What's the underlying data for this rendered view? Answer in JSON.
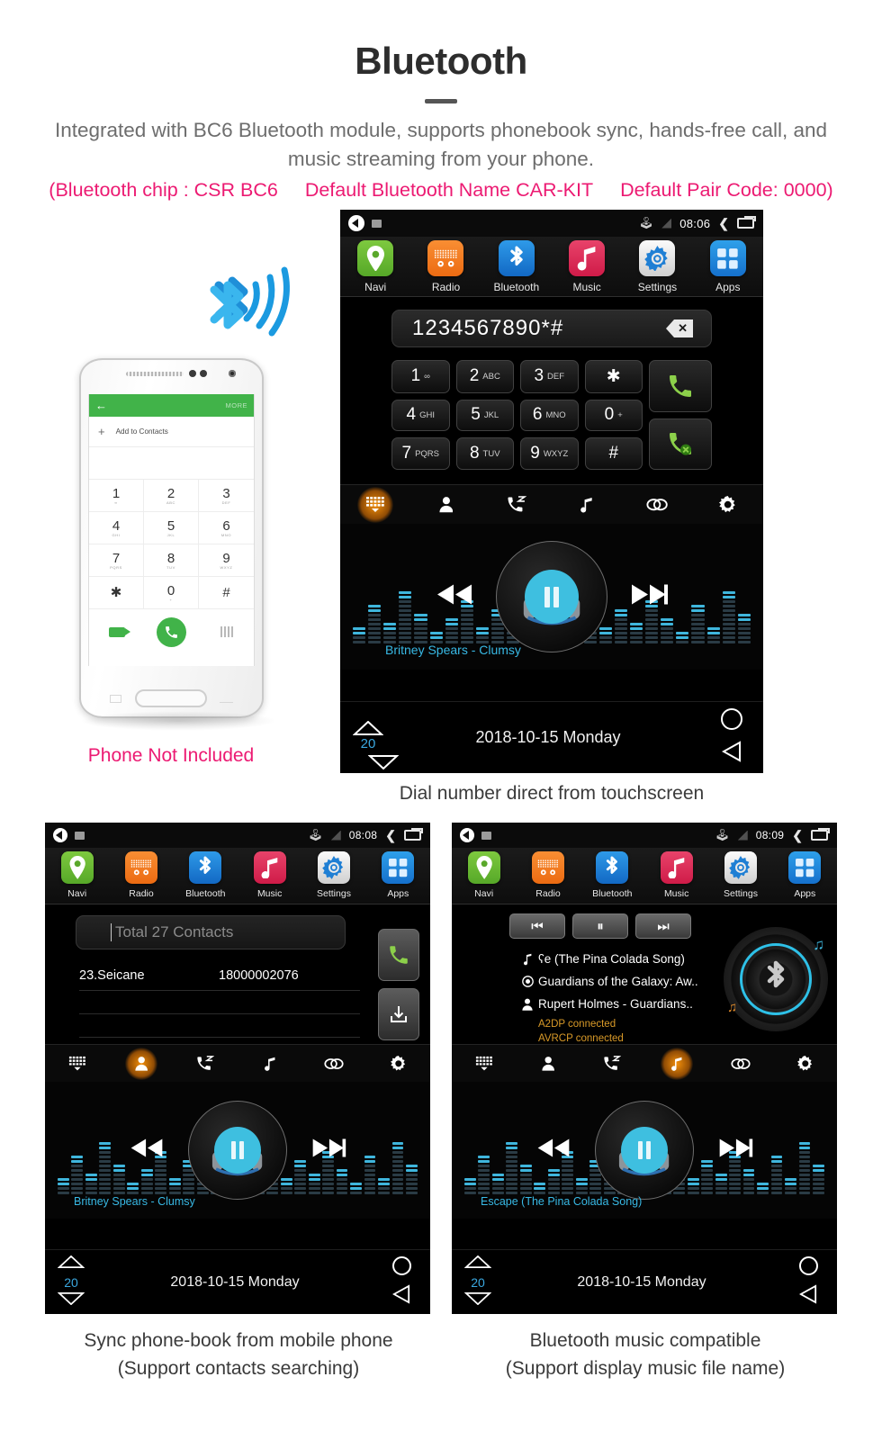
{
  "header": {
    "title": "Bluetooth",
    "subtitle": "Integrated with BC6 Bluetooth module, supports phonebook sync, hands-free call, and music streaming from your phone.",
    "spec_chip": "(Bluetooth chip : CSR BC6",
    "spec_name": "Default Bluetooth Name CAR-KIT",
    "spec_pair": "Default Pair Code: 0000)",
    "accent_pink": "#ec1a72",
    "body_gray": "#6d6d6d"
  },
  "phone_mock": {
    "appbar_back": "←",
    "appbar_more": "MORE",
    "add_label": "Add to Contacts",
    "keys": [
      {
        "num": "1",
        "sub": "∞"
      },
      {
        "num": "2",
        "sub": "ABC"
      },
      {
        "num": "3",
        "sub": "DEF"
      },
      {
        "num": "4",
        "sub": "GHI"
      },
      {
        "num": "5",
        "sub": "JKL"
      },
      {
        "num": "6",
        "sub": "MNO"
      },
      {
        "num": "7",
        "sub": "PQRS"
      },
      {
        "num": "8",
        "sub": "TUV"
      },
      {
        "num": "9",
        "sub": "WXYZ"
      },
      {
        "num": "✱",
        "sub": ""
      },
      {
        "num": "0",
        "sub": "+"
      },
      {
        "num": "#",
        "sub": ""
      }
    ],
    "not_included": "Phone Not Included"
  },
  "apps": [
    {
      "label": "Navi",
      "icon": "location-pin-icon"
    },
    {
      "label": "Radio",
      "icon": "radio-icon"
    },
    {
      "label": "Bluetooth",
      "icon": "bluetooth-icon"
    },
    {
      "label": "Music",
      "icon": "music-note-icon"
    },
    {
      "label": "Settings",
      "icon": "gear-icon"
    },
    {
      "label": "Apps",
      "icon": "grid-apps-icon"
    }
  ],
  "function_tabs": [
    {
      "name": "keypad",
      "icon": "dialpad-icon"
    },
    {
      "name": "contacts",
      "icon": "person-icon"
    },
    {
      "name": "calllog",
      "icon": "call-history-icon"
    },
    {
      "name": "btmusic",
      "icon": "music-note-icon"
    },
    {
      "name": "link",
      "icon": "link-icon"
    },
    {
      "name": "settings",
      "icon": "gear-outline-icon"
    }
  ],
  "screen_main": {
    "status": {
      "time": "08:06",
      "bluetooth": "bluetooth-icon",
      "signal": "no-signal-icon"
    },
    "dialed_number": "1234567890*#",
    "backspace_icon": "backspace-icon",
    "keypad": [
      {
        "num": "1",
        "sub": "∞"
      },
      {
        "num": "2",
        "sub": "ABC"
      },
      {
        "num": "3",
        "sub": "DEF"
      },
      {
        "num": "✱",
        "sub": ""
      },
      {
        "num": "4",
        "sub": "GHI"
      },
      {
        "num": "5",
        "sub": "JKL"
      },
      {
        "num": "6",
        "sub": "MNO"
      },
      {
        "num": "0",
        "sub": "+"
      },
      {
        "num": "7",
        "sub": "PQRS"
      },
      {
        "num": "8",
        "sub": "TUV"
      },
      {
        "num": "9",
        "sub": "WXYZ"
      },
      {
        "num": "#",
        "sub": ""
      }
    ],
    "call_button": "answer-call-icon",
    "hangup_button": "end-call-icon",
    "active_tab": 0,
    "track": "Britney Spears - Clumsy",
    "bottom": {
      "volume": "20",
      "date": "2018-10-15  Monday"
    },
    "caption": "Dial number direct from touchscreen"
  },
  "screen_contacts": {
    "status": {
      "time": "08:08"
    },
    "search_placeholder": "Total 27 Contacts",
    "rows": [
      {
        "name": "23.Seicane",
        "number": "18000002076"
      }
    ],
    "side_buttons": [
      {
        "name": "call-button",
        "icon": "answer-call-icon"
      },
      {
        "name": "download-contacts-button",
        "icon": "download-icon"
      }
    ],
    "active_tab": 1,
    "track": "Britney Spears - Clumsy",
    "bottom": {
      "volume": "20",
      "date": "2018-10-15  Monday"
    },
    "caption_line1": "Sync phone-book from mobile phone",
    "caption_line2": "(Support contacts searching)"
  },
  "screen_btmusic": {
    "status": {
      "time": "08:09"
    },
    "controls": [
      {
        "name": "previous-button",
        "glyph": "⏮"
      },
      {
        "name": "pause-button",
        "glyph": "⏸"
      },
      {
        "name": "next-button",
        "glyph": "⏭"
      }
    ],
    "info": [
      {
        "icon": "music-note-icon",
        "text": "ʕe (The Pina Colada Song)"
      },
      {
        "icon": "album-icon",
        "text": "Guardians of the Galaxy: Aw.."
      },
      {
        "icon": "person-icon",
        "text": "Rupert Holmes - Guardians.."
      }
    ],
    "connections": [
      "A2DP  connected",
      "AVRCP  connected"
    ],
    "active_tab": 3,
    "track": "Escape (The Pina Colada Song)",
    "bottom": {
      "volume": "20",
      "date": "2018-10-15  Monday"
    },
    "caption_line1": "Bluetooth music compatible",
    "caption_line2": "(Support display music file name)"
  },
  "colors": {
    "cyan": "#38b9e5",
    "orange_active": "#ff8a00",
    "amber_text": "#d99a28",
    "green_call": "#8cd04a"
  }
}
